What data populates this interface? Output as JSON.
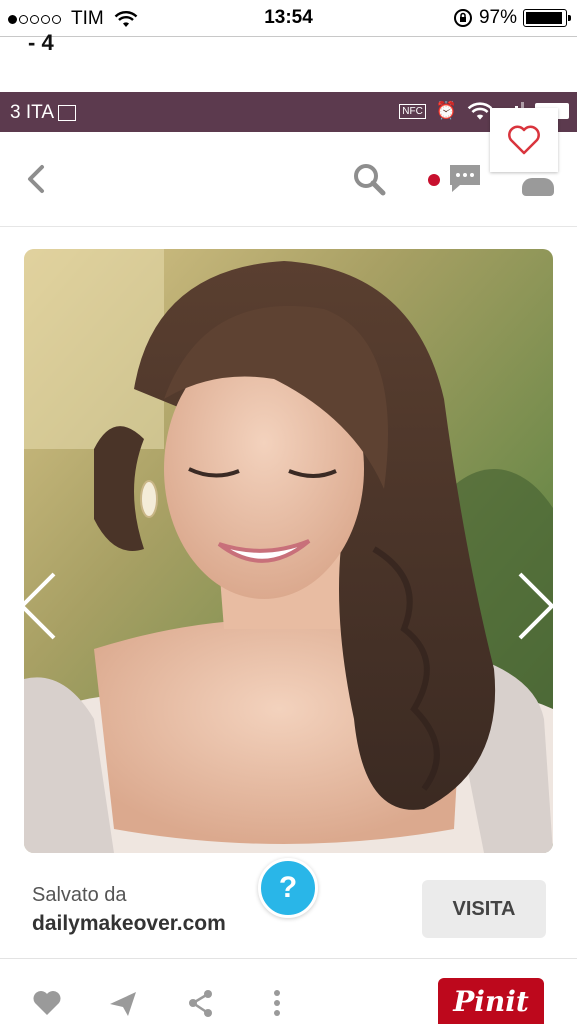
{
  "ios_status": {
    "carrier": "TIM",
    "time": "13:54",
    "battery": "97%",
    "signal_bars_filled": 1,
    "signal_bars_total": 5
  },
  "article": {
    "fragment": "- 4"
  },
  "inner_status": {
    "carrier": "3 ITA",
    "nfc": "NFC"
  },
  "toolbar": {
    "icons": [
      "back-icon",
      "search-icon",
      "message-icon",
      "profile-icon",
      "heart-icon"
    ]
  },
  "pin": {
    "saved_label": "Salvato da",
    "source": "dailymakeover.com",
    "visit_label": "VISITA",
    "help_label": "?",
    "pin_it_label": "Pinit"
  },
  "colors": {
    "accent_red": "#bd081c",
    "help_blue": "#29b6e8",
    "inner_bar": "#5c3a4e"
  }
}
